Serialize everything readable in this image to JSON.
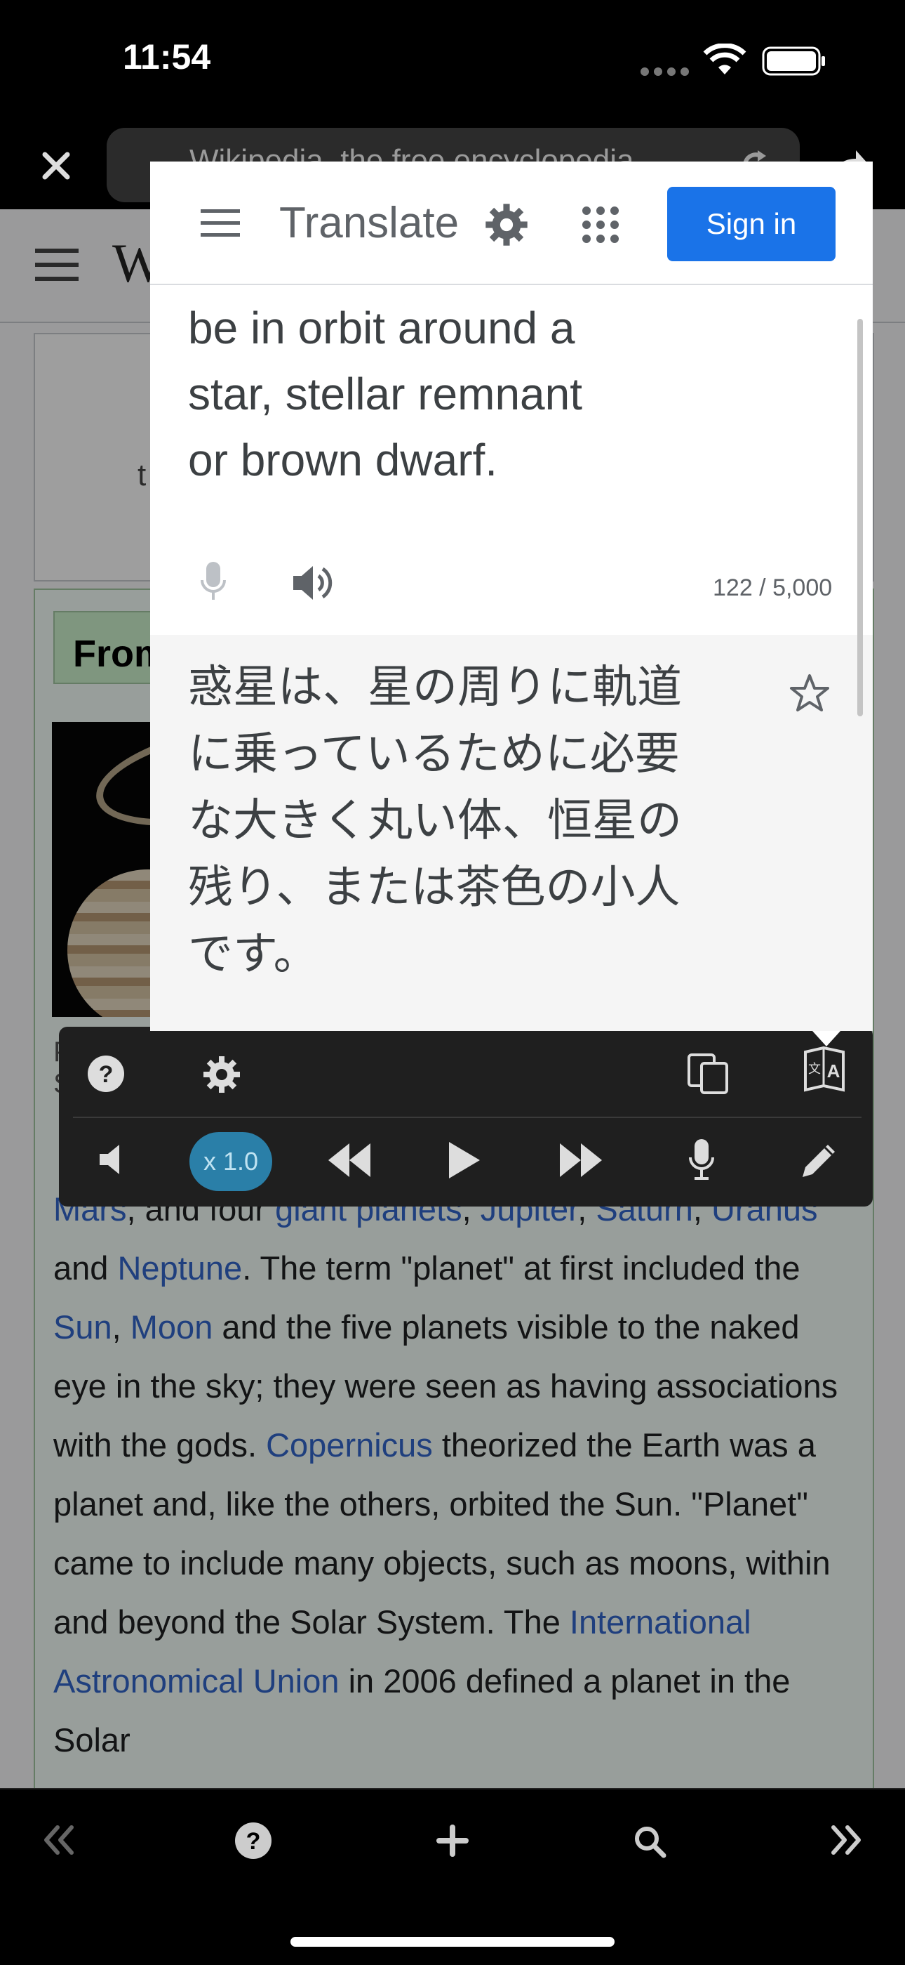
{
  "status_bar": {
    "time": "11:54"
  },
  "browser": {
    "url_text": "Wikipedia, the free encyclopedia"
  },
  "wiki": {
    "logo_text": "W",
    "from_label": "From",
    "article_segments": [
      {
        "t": "Mars",
        "link": true
      },
      {
        "t": ", and four ",
        "link": false
      },
      {
        "t": "giant planets",
        "link": true
      },
      {
        "t": ", ",
        "link": false
      },
      {
        "t": "Jupiter",
        "link": true
      },
      {
        "t": ", ",
        "link": false
      },
      {
        "t": "Saturn",
        "link": true
      },
      {
        "t": ", ",
        "link": false
      },
      {
        "t": "Uranus",
        "link": true
      },
      {
        "t": " and ",
        "link": false
      },
      {
        "t": "Neptune",
        "link": true
      },
      {
        "t": ". The term \"planet\" at first included the ",
        "link": false
      },
      {
        "t": "Sun",
        "link": true
      },
      {
        "t": ", ",
        "link": false
      },
      {
        "t": "Moon",
        "link": true
      },
      {
        "t": " and the five planets visible to the naked eye in the sky; they were seen as having associations with the gods. ",
        "link": false
      },
      {
        "t": "Copernicus",
        "link": true
      },
      {
        "t": " theorized the Earth was a planet and, like the others, orbited the Sun. \"Planet\" came to include many objects, such as moons, within and beyond the Solar System. The ",
        "link": false
      },
      {
        "t": "International Astronomical Union",
        "link": true
      },
      {
        "t": " in 2006 defined a planet in the Solar",
        "link": false
      }
    ]
  },
  "translate": {
    "title": "Translate",
    "sign_in": "Sign in",
    "source_lines": [
      "be in orbit around a",
      "star, stellar remnant",
      "or brown dwarf."
    ],
    "char_count": "122 / 5,000",
    "result_text": "惑星は、星の周りに軌道に乗っているために必要な大きく丸い体、恒星の残り、または茶色の小人です。",
    "result_lines": [
      "惑星は、星の周りに軌道",
      "に乗っているために必要",
      "な大きく丸い体、恒星の",
      "残り、または茶色の小人",
      "です。"
    ]
  },
  "reader": {
    "speed": "x 1.0"
  },
  "icons": {
    "close": "close-icon",
    "reload": "reload-icon",
    "share": "share-icon",
    "menu": "hamburger-menu-icon",
    "settings": "gear-icon",
    "apps": "apps-grid-icon",
    "mic": "microphone-icon",
    "speaker": "speaker-icon",
    "star": "star-icon",
    "help": "help-circle-icon",
    "copy": "copy-icon",
    "translate": "translate-icon",
    "volume": "volume-icon",
    "rewind": "rewind-icon",
    "play": "play-icon",
    "fast_forward": "fast-forward-icon",
    "edit": "pencil-icon",
    "back": "double-chevron-left-icon",
    "add": "plus-icon",
    "search": "search-icon",
    "forward": "double-chevron-right-icon"
  },
  "colors": {
    "accent": "#1a73e8",
    "link": "#3366cc",
    "speed_pill": "#2a7fa8"
  }
}
